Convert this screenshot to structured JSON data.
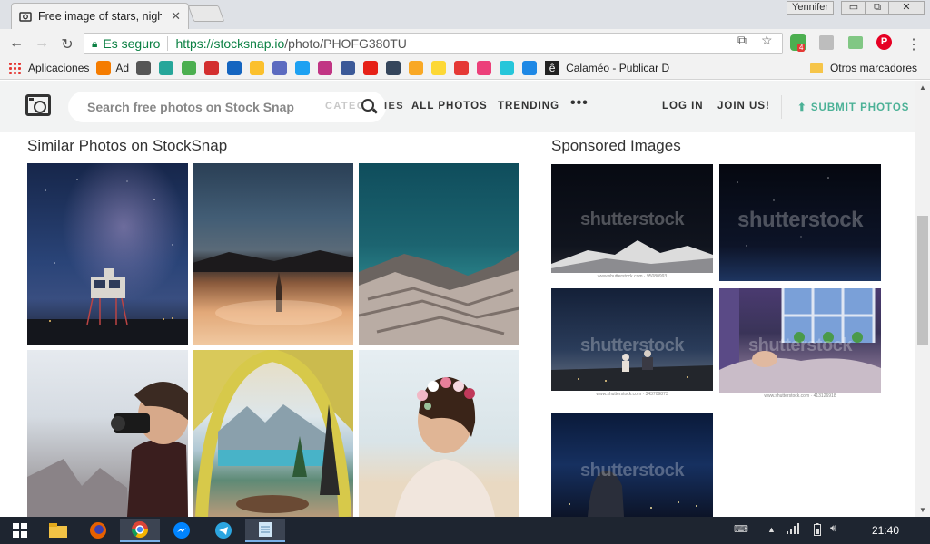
{
  "browser": {
    "tab_title": "Free image of stars, nigh",
    "tab_close": "✕",
    "user_name": "Yennifer",
    "controls": {
      "minimize": "▭",
      "maximize": "⧉",
      "close": "✕"
    },
    "secure_label": "Es seguro",
    "url_prefix": "https://",
    "url_host": "stocksnap.io",
    "url_path": "/photo/PHOFG380TU",
    "extension_badge": "4"
  },
  "bookmarks": {
    "items": [
      {
        "label": "Aplicaciones",
        "icon": "apps-grid-icon",
        "color": "#e53935"
      },
      {
        "label": "Ad",
        "icon": "blogger-icon",
        "color": "#f57c00"
      }
    ],
    "icon_only": [
      {
        "icon": "bookmark-1-icon",
        "color": "#555555"
      },
      {
        "icon": "bookmark-2-icon",
        "color": "#26a69a"
      },
      {
        "icon": "windows-icon",
        "color": "#4caf50"
      },
      {
        "icon": "gmail-icon",
        "color": "#d32f2f"
      },
      {
        "icon": "bookmark-5-icon",
        "color": "#1565c0"
      },
      {
        "icon": "bookmark-6-icon",
        "color": "#fbc02d"
      },
      {
        "icon": "bookmark-7-icon",
        "color": "#5c6bc0"
      },
      {
        "icon": "twitter-icon",
        "color": "#1da1f2"
      },
      {
        "icon": "instagram-icon",
        "color": "#c13584"
      },
      {
        "icon": "facebook-icon",
        "color": "#3b5998"
      },
      {
        "icon": "youtube-icon",
        "color": "#e62117"
      },
      {
        "icon": "tumblr-icon",
        "color": "#35465c"
      },
      {
        "icon": "bookmark-13-icon",
        "color": "#f9a825"
      },
      {
        "icon": "bookmark-14-icon",
        "color": "#fdd835"
      },
      {
        "icon": "bookmark-15-icon",
        "color": "#e53935"
      },
      {
        "icon": "bookmark-16-icon",
        "color": "#ec407a"
      },
      {
        "icon": "bookmark-17-icon",
        "color": "#26c6da"
      },
      {
        "icon": "issuu-icon",
        "color": "#1e88e5"
      }
    ],
    "calameo": "Calaméo - Publicar D",
    "calameo_glyph": "ê",
    "other": "Otros marcadores"
  },
  "site": {
    "search_placeholder": "Search free photos on Stock Snap",
    "categories_faded": "CATEG",
    "categories_end": "IES",
    "nav": {
      "all_photos": "ALL PHOTOS",
      "trending": "TRENDING",
      "more": "•••",
      "login": "LOG IN",
      "join": "JOIN US!",
      "submit": "SUBMIT PHOTOS"
    }
  },
  "main": {
    "similar_title": "Similar Photos on StockSnap",
    "sponsored_title": "Sponsored Images",
    "watermark": "shutterstock",
    "captions": [
      "www.shutterstock.com · 95080993",
      "",
      "www.shutterstock.com · 343709873",
      "www.shutterstock.com · 413126918",
      ""
    ]
  },
  "taskbar": {
    "clock": "21:40",
    "tray_up": "▲"
  },
  "colors": {
    "accent": "#4bb196",
    "secure": "#0b8043",
    "taskbar": "#1e2530"
  }
}
